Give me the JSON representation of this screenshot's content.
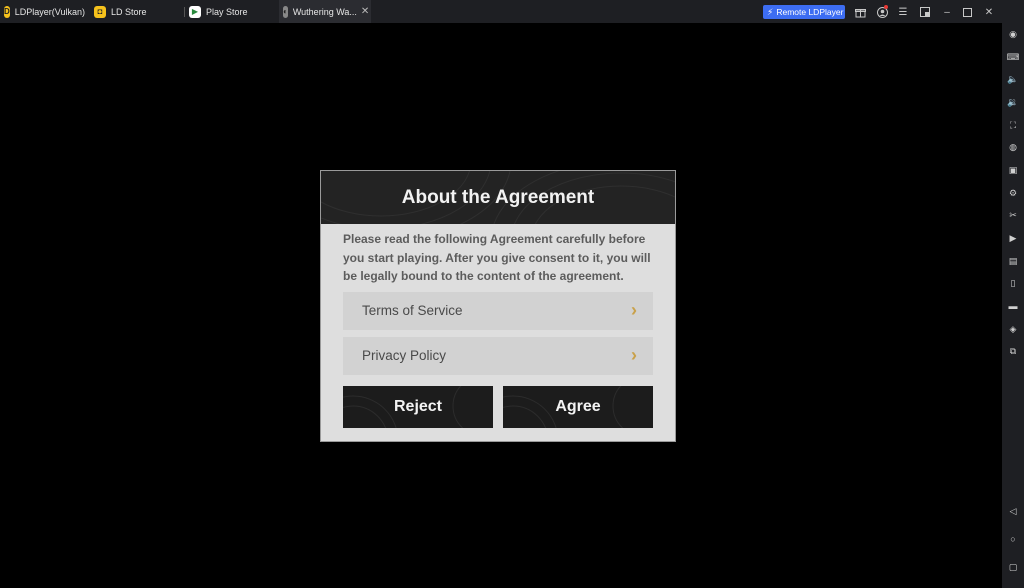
{
  "tabs": [
    {
      "label": "LDPlayer(Vulkan)",
      "icon": "ldplayer-icon"
    },
    {
      "label": "LD Store",
      "icon": "ld-store-icon"
    },
    {
      "label": "Play Store",
      "icon": "play-store-icon"
    },
    {
      "label": "Wuthering Wa...",
      "icon": "game-icon"
    }
  ],
  "titlebar": {
    "remote_label": "Remote LDPlayer",
    "icons": [
      "gift-icon",
      "account-icon",
      "menu-icon",
      "pip-icon",
      "minimize-icon",
      "maximize-icon",
      "close-icon"
    ]
  },
  "sidebar_icons": [
    "screenshot-icon",
    "keyboard-icon",
    "volume-up-icon",
    "volume-down-icon",
    "fullscreen-icon",
    "mouse-icon",
    "apk-icon",
    "robot-icon",
    "operation-icon",
    "record-icon",
    "sync-icon",
    "shake-icon",
    "folder-icon",
    "location-icon",
    "multi-instance-icon",
    "back-icon",
    "home-icon",
    "recent-apps-icon"
  ],
  "dialog": {
    "title": "About the Agreement",
    "text_line1": "Please read the following Agreement carefully before",
    "text_line2": "you start playing. After you give consent to it, you will",
    "text_line3": "be legally bound to the content of the agreement.",
    "terms_label": "Terms of Service",
    "privacy_label": "Privacy Policy",
    "reject_label": "Reject",
    "agree_label": "Agree"
  },
  "colors": {
    "accent": "#3d6df2",
    "chevron": "#c9a14a",
    "dialog_bg": "#dedede",
    "button_bg": "#1c1c1c"
  }
}
